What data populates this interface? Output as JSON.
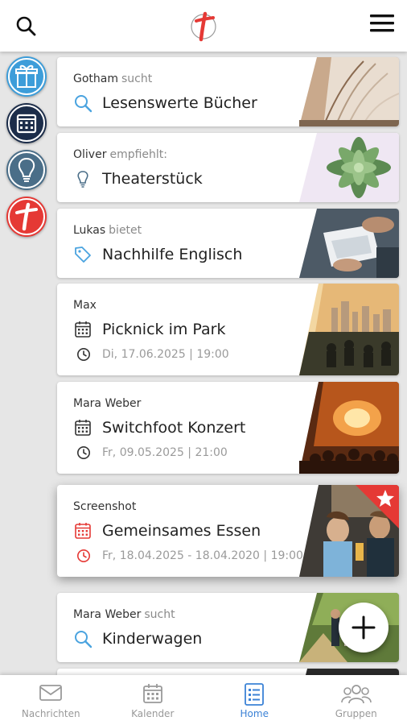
{
  "header": {
    "logo": "cross-logo"
  },
  "rail": {
    "items": [
      {
        "icon": "gift-icon",
        "color": "#3d9dd9"
      },
      {
        "icon": "calendar-icon",
        "color": "#1c2d4a"
      },
      {
        "icon": "lightbulb-icon",
        "color": "#4a6e88"
      },
      {
        "icon": "cross-logo-icon",
        "color": "#e53935"
      }
    ]
  },
  "feed": [
    {
      "author": "Gotham",
      "verb": "sucht",
      "icon": "search-icon",
      "title": "Lesenswerte Bücher",
      "image": "book-pages"
    },
    {
      "author": "Oliver",
      "verb": "empfiehlt:",
      "icon": "lightbulb-icon",
      "title": "Theaterstück",
      "image": "succulent"
    },
    {
      "author": "Lukas",
      "verb": "bietet",
      "icon": "tag-icon",
      "title": "Nachhilfe Englisch",
      "image": "desk-work"
    },
    {
      "author": "Max",
      "verb": "",
      "icon": "calendar-icon",
      "title": "Picknick im Park",
      "date": "Di, 17.06.2025 | 19:00",
      "image": "park-skyline"
    },
    {
      "author": "Mara Weber",
      "verb": "",
      "icon": "calendar-icon",
      "title": "Switchfoot Konzert",
      "date": "Fr, 09.05.2025 | 21:00",
      "image": "concert"
    },
    {
      "author": "Screenshot",
      "verb": "",
      "icon": "calendar-icon",
      "title": "Gemeinsames Essen",
      "date": "Fr, 18.04.2025 - 18.04.2020 | 19:00",
      "image": "friends-dinner",
      "highlight": true,
      "accent": "#e53935"
    },
    {
      "author": "Mara Weber",
      "verb": "sucht",
      "icon": "search-icon",
      "title": "Kinderwagen",
      "image": "walking-couple"
    }
  ],
  "nav": {
    "items": [
      {
        "label": "Nachrichten",
        "icon": "mail-icon",
        "active": false
      },
      {
        "label": "Kalender",
        "icon": "calendar-icon",
        "active": false
      },
      {
        "label": "Home",
        "icon": "list-icon",
        "active": true
      },
      {
        "label": "Gruppen",
        "icon": "group-icon",
        "active": false
      }
    ]
  },
  "colors": {
    "accent_blue": "#3b82d6",
    "accent_red": "#e53935",
    "icon_blue": "#4aa3df"
  }
}
